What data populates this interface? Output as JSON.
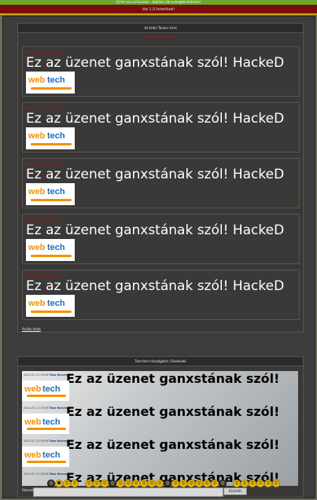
{
  "top_bar": {
    "text": "Új hír van a Fórumon - kattints ide a megtekintéshez!"
  },
  "red_bar": {
    "text": "Van 1 (1 Ismerőssel)"
  },
  "news": {
    "title": "Az Erdei Tanács hírei",
    "subtitle": "Nincsenek hírek",
    "messages": [
      {
        "date": "2012-07-11 03:56:16",
        "text": "Ez az üzenet ganxstának szól! HackeD"
      },
      {
        "date": "2012-07-11 03:56:16",
        "text": "Ez az üzenet ganxstának szól! HackeD"
      },
      {
        "date": "2012-07-11 03:56:16",
        "text": "Ez az üzenet ganxstának szól! HackeD"
      },
      {
        "date": "2012-07-11 03:56:16",
        "text": "Ez az üzenet ganxstának szól! HackeD"
      },
      {
        "date": "2012-07-11 03:56:16",
        "text": "Ez az üzenet ganxstának szól! HackeD"
      }
    ],
    "archive_link": "Archív hírek"
  },
  "logo": {
    "text_web": "web",
    "text_tech": "tech"
  },
  "chat": {
    "title": "Tam-tam hírszolgálat / Okoskodó",
    "messages": [
      {
        "meta": "2012-07-11 03:56",
        "user": "Tosz Harvey",
        "text": "Ez az üzenet ganxstának szól!"
      },
      {
        "meta": "2012-07-11 03:56",
        "user": "Tosz Harvey",
        "text": "Ez az üzenet ganxstának szól!"
      },
      {
        "meta": "2012-07-11 03:56",
        "user": "Tosz Harvey",
        "text": "Ez az üzenet ganxstának szól!"
      },
      {
        "meta": "2012-07-11 03:56",
        "user": "Tosz Harvey",
        "text": "Ez az üzenet ganxstának szól!"
      }
    ],
    "input_label": "Üzenet:",
    "input_value": "",
    "send_label": "Elküldés"
  },
  "smileys": [
    "☺",
    "☻",
    "☺",
    "☺",
    "☺",
    "☺",
    "☺",
    "☺",
    "☺",
    "☺",
    "☺",
    "☺",
    "☺",
    "☺",
    "☺",
    "☺",
    "☺",
    "☺",
    "☺",
    "☺",
    "☺",
    "☺",
    "☺",
    "☺",
    "☺",
    "☺",
    "☺",
    "☺"
  ]
}
